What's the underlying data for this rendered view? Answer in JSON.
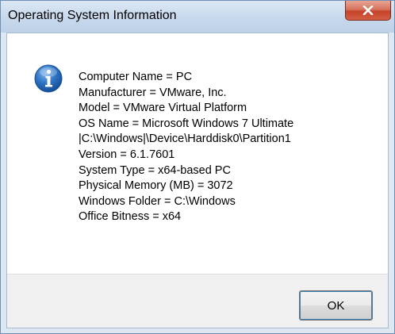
{
  "window": {
    "title": "Operating System Information"
  },
  "icons": {
    "dialog_icon": "information-icon",
    "close_icon": "close-icon"
  },
  "message": {
    "lines": [
      "Computer Name = PC",
      "Manufacturer = VMware, Inc.",
      "Model = VMware Virtual Platform",
      "OS Name = Microsoft Windows 7 Ultimate",
      "|C:\\Windows|\\Device\\Harddisk0\\Partition1",
      "Version = 6.1.7601",
      "System Type = x64-based PC",
      "Physical Memory (MB) = 3072",
      "Windows Folder = C:\\Windows",
      "Office Bitness = x64"
    ]
  },
  "buttons": {
    "ok_label": "OK"
  },
  "colors": {
    "close_button": "#c5422b",
    "info_icon": "#2a6ab8",
    "button_area": "#f0f0f0"
  }
}
